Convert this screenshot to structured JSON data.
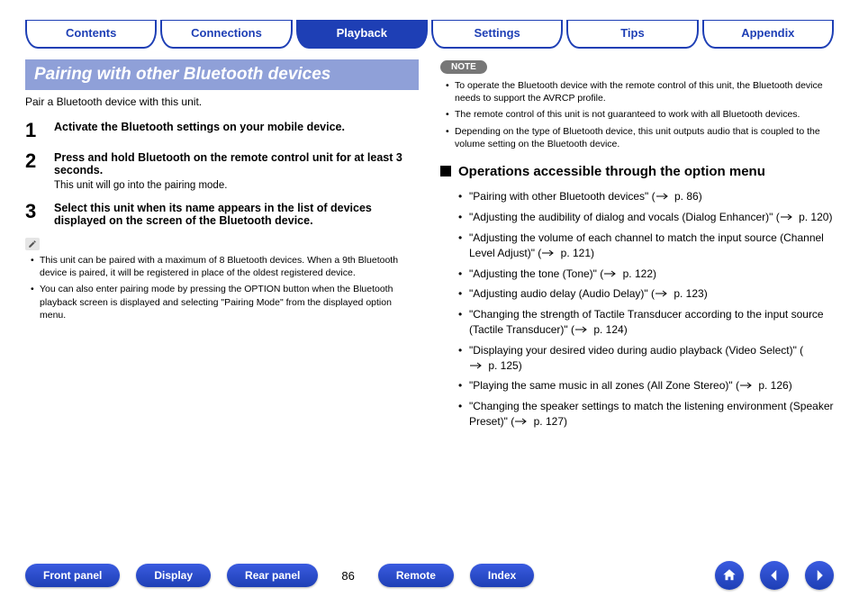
{
  "tabs": {
    "items": [
      "Contents",
      "Connections",
      "Playback",
      "Settings",
      "Tips",
      "Appendix"
    ],
    "active_index": 2
  },
  "section_title": "Pairing with other Bluetooth devices",
  "intro": "Pair a Bluetooth device with this unit.",
  "steps": [
    {
      "num": "1",
      "title": "Activate the Bluetooth settings on your mobile device.",
      "sub": ""
    },
    {
      "num": "2",
      "title": "Press and hold Bluetooth on the remote control unit for at least 3 seconds.",
      "sub": "This unit will go into the pairing mode."
    },
    {
      "num": "3",
      "title": "Select this unit when its name appears in the list of devices displayed on the screen of the Bluetooth device.",
      "sub": ""
    }
  ],
  "left_notes": [
    "This unit can be paired with a maximum of 8 Bluetooth devices. When a 9th Bluetooth device is paired, it will be registered in place of the oldest registered device.",
    "You can also enter pairing mode by pressing the OPTION button when the Bluetooth playback screen is displayed and selecting \"Pairing Mode\" from the displayed option menu."
  ],
  "note_label": "NOTE",
  "right_notes": [
    "To operate the Bluetooth device with the remote control of this unit, the Bluetooth device needs to support the AVRCP profile.",
    "The remote control of this unit is not guaranteed to work with all Bluetooth devices.",
    "Depending on the type of Bluetooth device, this unit outputs audio that is coupled to the volume setting on the Bluetooth device."
  ],
  "ops_heading": "Operations accessible through the option menu",
  "ops": [
    {
      "text": "\"Pairing with other Bluetooth devices\"",
      "page": "p. 86"
    },
    {
      "text": "\"Adjusting the audibility of dialog and vocals (Dialog Enhancer)\"",
      "page": "p. 120"
    },
    {
      "text": "\"Adjusting the volume of each channel to match the input source (Channel Level Adjust)\"",
      "page": "p. 121"
    },
    {
      "text": "\"Adjusting the tone (Tone)\"",
      "page": "p. 122"
    },
    {
      "text": "\"Adjusting audio delay (Audio Delay)\"",
      "page": "p. 123"
    },
    {
      "text": "\"Changing the strength of Tactile Transducer according to the input source (Tactile Transducer)\"",
      "page": "p. 124"
    },
    {
      "text": "\"Displaying your desired video during audio playback (Video Select)\"",
      "page": "p. 125"
    },
    {
      "text": "\"Playing the same music in all zones (All Zone Stereo)\"",
      "page": "p. 126"
    },
    {
      "text": "\"Changing the speaker settings to match the listening environment (Speaker Preset)\"",
      "page": "p. 127"
    }
  ],
  "bottom": {
    "pills": [
      "Front panel",
      "Display",
      "Rear panel"
    ],
    "page_number": "86",
    "pills2": [
      "Remote",
      "Index"
    ]
  }
}
